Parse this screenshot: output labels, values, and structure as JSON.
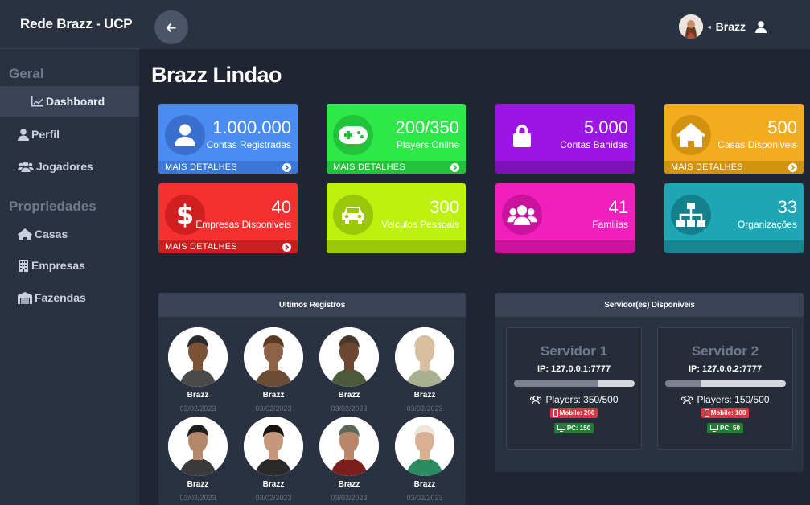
{
  "sidebar": {
    "brand": "Rede Brazz - UCP",
    "section_geral": "Geral",
    "section_propriedades": "Propriedades",
    "items": [
      {
        "label": "Dashboard"
      },
      {
        "label": "Perfil"
      },
      {
        "label": "Jogadores"
      },
      {
        "label": "Casas"
      },
      {
        "label": "Empresas"
      },
      {
        "label": "Fazendas"
      }
    ]
  },
  "topbar": {
    "username": "Brazz"
  },
  "page_title": "Brazz Lindao",
  "cards": [
    {
      "value": "1.000.000",
      "label": "Contas Registradas",
      "footer": "MAIS DETALHES",
      "color": "#4a8cf0",
      "foot_color": "#3b78d8",
      "circle": "#3a6fd0",
      "icon": "user-icon"
    },
    {
      "value": "200/350",
      "label": "Players Online",
      "footer": "MAIS DETALHES",
      "color": "#2ee84a",
      "foot_color": "#22c23b",
      "circle": "#22c23b",
      "icon": "gamepad-icon"
    },
    {
      "value": "5.000",
      "label": "Contas Banidas",
      "footer": "",
      "color": "#9b15e3",
      "foot_color": "#7d10b8",
      "circle": "#9b15e3",
      "icon": "lock-icon"
    },
    {
      "value": "500",
      "label": "Casas Disponiveis",
      "footer": "MAIS DETALHES",
      "color": "#f2ac1e",
      "foot_color": "#d2920f",
      "circle": "#d2920f",
      "icon": "house-icon"
    },
    {
      "value": "40",
      "label": "Empresas Disponiveis",
      "footer": "MAIS DETALHES",
      "color": "#f53030",
      "foot_color": "#c81f1f",
      "circle": "#d01f1f",
      "icon": "dollar-icon"
    },
    {
      "value": "300",
      "label": "Veiculos Pessoais",
      "footer": "",
      "color": "#bcf20e",
      "foot_color": "#9ac707",
      "circle": "#9ac707",
      "icon": "car-icon"
    },
    {
      "value": "41",
      "label": "Familias",
      "footer": "",
      "color": "#f21fbf",
      "foot_color": "#c9139c",
      "circle": "#c9139c",
      "icon": "users-icon"
    },
    {
      "value": "33",
      "label": "Organizações",
      "footer": "",
      "color": "#1ea6b4",
      "foot_color": "#148591",
      "circle": "#14808b",
      "icon": "sitemap-icon"
    }
  ],
  "registros": {
    "title": "Ultimos Registros",
    "players": [
      {
        "name": "Brazz",
        "date": "03/02/2023"
      },
      {
        "name": "Brazz",
        "date": "03/02/2023"
      },
      {
        "name": "Brazz",
        "date": "03/02/2023"
      },
      {
        "name": "Brazz",
        "date": "03/02/2023"
      },
      {
        "name": "Brazz",
        "date": "03/02/2023"
      },
      {
        "name": "Brazz",
        "date": "03/02/2023"
      },
      {
        "name": "Brazz",
        "date": "03/02/2023"
      },
      {
        "name": "Brazz",
        "date": "03/02/2023"
      }
    ]
  },
  "servidores": {
    "title": "Servidor(es) Disponiveis",
    "servers": [
      {
        "name": "Servidor 1",
        "ip": "IP: 127.0.0.1:7777",
        "players": "Players: 350/500",
        "progress": 0.7,
        "mobile": "Mobile: 200",
        "pc": "PC: 150"
      },
      {
        "name": "Servidor 2",
        "ip": "IP: 127.0.0.2:7777",
        "players": "Players: 150/500",
        "progress": 0.3,
        "mobile": "Mobile: 100",
        "pc": "PC: 50"
      }
    ]
  }
}
